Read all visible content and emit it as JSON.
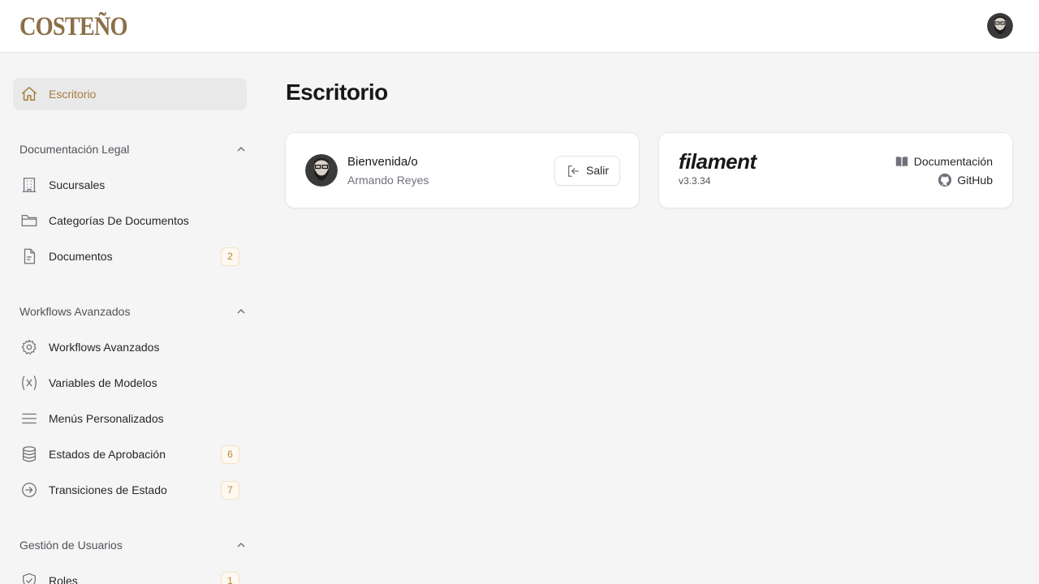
{
  "brand": {
    "name": "COSTEÑO"
  },
  "user": {
    "avatar_icon": "user-avatar",
    "name": "Armando Reyes"
  },
  "page": {
    "title": "Escritorio"
  },
  "sidebar": {
    "home": {
      "label": "Escritorio",
      "icon": "home-icon"
    },
    "groups": [
      {
        "title": "Documentación Legal",
        "items": [
          {
            "label": "Sucursales",
            "icon": "building-icon",
            "badge": ""
          },
          {
            "label": "Categorías De Documentos",
            "icon": "folder-icon",
            "badge": ""
          },
          {
            "label": "Documentos",
            "icon": "document-icon",
            "badge": "2"
          }
        ]
      },
      {
        "title": "Workflows Avanzados",
        "items": [
          {
            "label": "Workflows Avanzados",
            "icon": "gear-icon",
            "badge": ""
          },
          {
            "label": "Variables de Modelos",
            "icon": "variable-icon",
            "badge": ""
          },
          {
            "label": "Menús Personalizados",
            "icon": "menu-bars-icon",
            "badge": ""
          },
          {
            "label": "Estados de Aprobación",
            "icon": "database-icon",
            "badge": "6"
          },
          {
            "label": "Transiciones de Estado",
            "icon": "arrow-circle-icon",
            "badge": "7"
          }
        ]
      },
      {
        "title": "Gestión de Usuarios",
        "items": [
          {
            "label": "Roles",
            "icon": "shield-check-icon",
            "badge": "1"
          }
        ]
      }
    ]
  },
  "account_widget": {
    "welcome": "Bienvenida/o",
    "name": "Armando Reyes",
    "logout_label": "Salir"
  },
  "filament_widget": {
    "logo": "filament",
    "version": "v3.3.34",
    "docs_label": "Documentación",
    "github_label": "GitHub"
  },
  "colors": {
    "accent": "#a67c3d",
    "brand": "#8b6f47",
    "badge_text": "#b7892f",
    "active_bg": "#e9e9e9"
  }
}
